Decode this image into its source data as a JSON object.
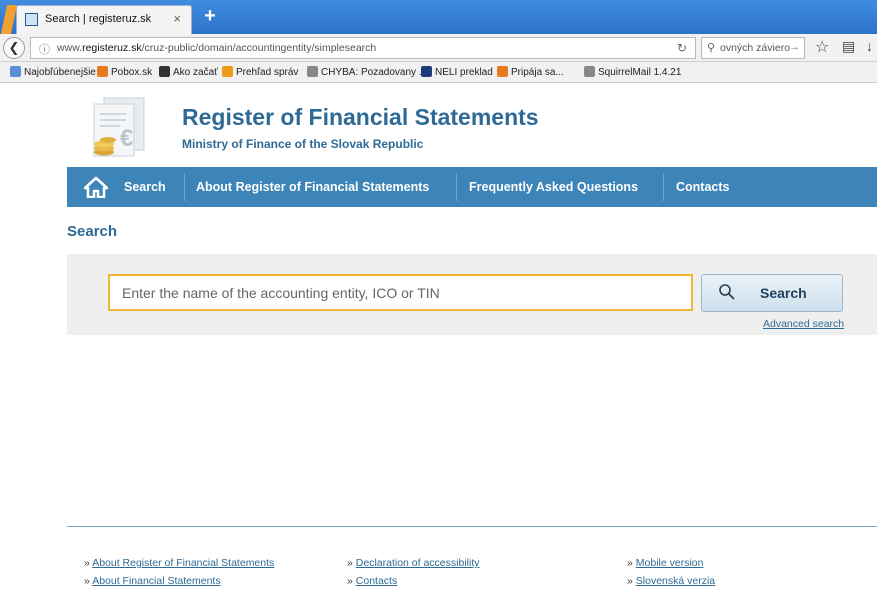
{
  "browser": {
    "tab_title": "Search | registeruz.sk",
    "tab_close": "×",
    "new_tab": "+",
    "url_prefix": "www.",
    "url_domain": "registeruz.sk",
    "url_path": "/cruz-public/domain/accountingentity/simplesearch",
    "search_box_text": "ovných závierok",
    "bookmarks": [
      {
        "label": "Najobľúbenejšie",
        "icon": "folder-icon",
        "color": "#5b8fd6"
      },
      {
        "label": "Pobox.sk",
        "icon": "pobox-icon",
        "color": "#e57c1e"
      },
      {
        "label": "Ako začať",
        "icon": "m-logo-icon",
        "color": "#333333"
      },
      {
        "label": "Prehľad správ",
        "icon": "rss-icon",
        "color": "#f09a1a"
      },
      {
        "label": "CHYBA: Pozadovany ...",
        "icon": "globe-icon",
        "color": "#888888"
      },
      {
        "label": "NELI preklad",
        "icon": "neli-icon",
        "color": "#1f3b7a"
      },
      {
        "label": "Pripája sa...",
        "icon": "pobox-icon",
        "color": "#e57c1e"
      },
      {
        "label": "SquirrelMail 1.4.21",
        "icon": "globe-icon",
        "color": "#888888"
      }
    ]
  },
  "header": {
    "title": "Register of Financial Statements",
    "subtitle": "Ministry of Finance of the Slovak Republic"
  },
  "nav": {
    "items": [
      {
        "label": "Search"
      },
      {
        "label": "About Register of Financial Statements"
      },
      {
        "label": "Frequently Asked Questions"
      },
      {
        "label": "Contacts"
      }
    ]
  },
  "main": {
    "heading": "Search",
    "search_placeholder": "Enter the name of the accounting entity, ICO or TIN",
    "search_button": "Search",
    "advanced_search": "Advanced search"
  },
  "footer": {
    "bullet": "»",
    "links": [
      {
        "label": "About Register of Financial Statements"
      },
      {
        "label": "About Financial Statements"
      },
      {
        "label": "Declaration of accessibility"
      },
      {
        "label": "Contacts"
      },
      {
        "label": "Mobile version"
      },
      {
        "label": "Slovenská verzia"
      }
    ]
  },
  "colors": {
    "brand_blue": "#2e6a96",
    "nav_blue": "#3d84b8",
    "input_border": "#f2b632"
  }
}
